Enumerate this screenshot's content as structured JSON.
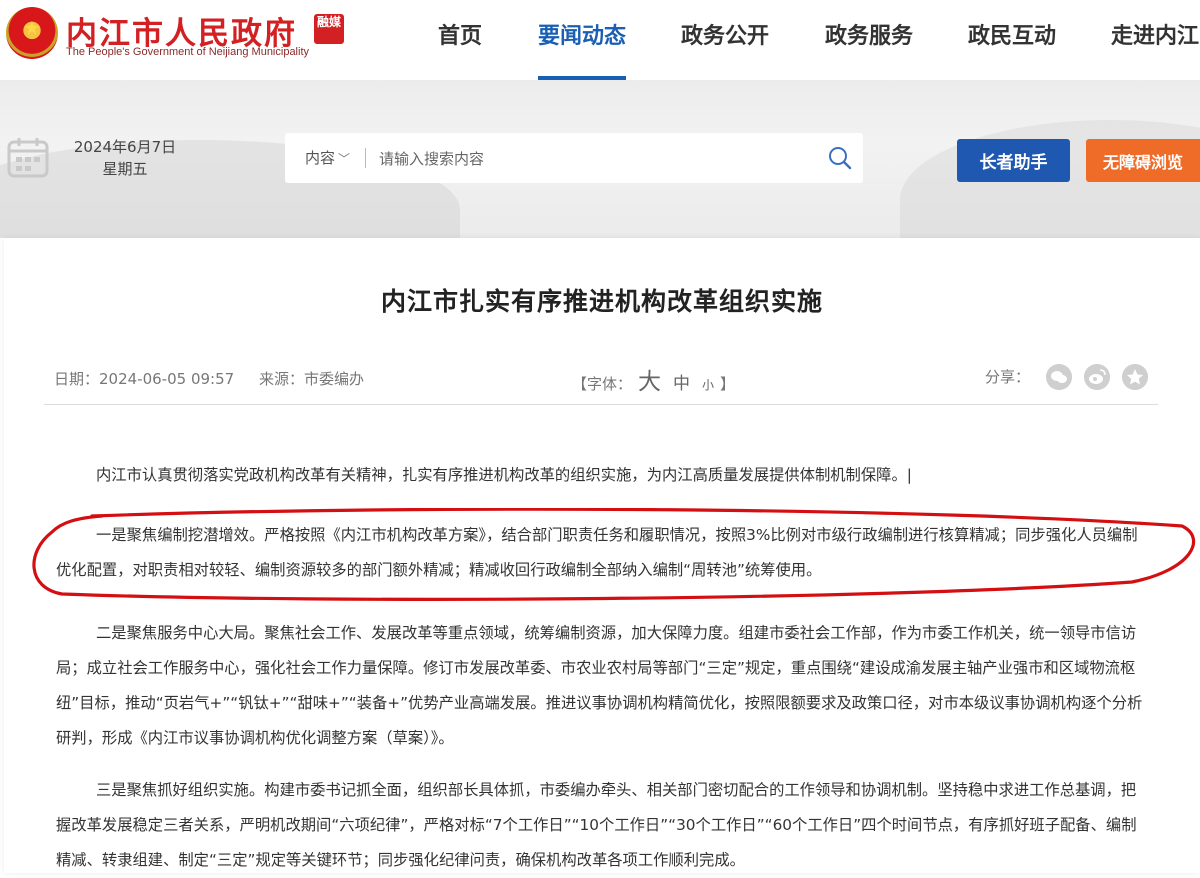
{
  "header": {
    "site_name": "内江市人民政府",
    "site_badge": "融媒",
    "site_english": "The People's Government of Neijiang Municipality",
    "nav": [
      {
        "label": "首页",
        "active": false
      },
      {
        "label": "要闻动态",
        "active": true
      },
      {
        "label": "政务公开",
        "active": false
      },
      {
        "label": "政务服务",
        "active": false
      },
      {
        "label": "政民互动",
        "active": false
      },
      {
        "label": "走进内江",
        "active": false
      }
    ]
  },
  "banner": {
    "date": "2024年6月7日",
    "weekday": "星期五",
    "search_scope": "内容",
    "search_placeholder": "请输入搜索内容",
    "elder_button": "长者助手",
    "access_button": "无障碍浏览"
  },
  "article": {
    "title": "内江市扎实有序推进机构改革组织实施",
    "date_label": "日期：2024-06-05 09:57",
    "source_label": "来源：市委编办",
    "font_label_open": "【字体：",
    "font_big": "大",
    "font_mid": "中",
    "font_small": "小",
    "font_label_close": "】",
    "share_label": "分享：",
    "paragraphs": [
      "内江市认真贯彻落实党政机构改革有关精神，扎实有序推进机构改革的组织实施，为内江高质量发展提供体制机制保障。|",
      "一是聚焦编制挖潜增效。严格按照《内江市机构改革方案》，结合部门职责任务和履职情况，按照3%比例对市级行政编制进行核算精减；同步强化人员编制优化配置，对职责相对较轻、编制资源较多的部门额外精减；精减收回行政编制全部纳入编制“周转池”统筹使用。",
      "二是聚焦服务中心大局。聚焦社会工作、发展改革等重点领域，统筹编制资源，加大保障力度。组建市委社会工作部，作为市委工作机关，统一领导市信访局；成立社会工作服务中心，强化社会工作力量保障。修订市发展改革委、市农业农村局等部门“三定”规定，重点围绕“建设成渝发展主轴产业强市和区域物流枢纽”目标，推动“页岩气+”“钒钛+”“甜味+”“装备+”优势产业高端发展。推进议事协调机构精简优化，按照限额要求及政策口径，对市本级议事协调机构逐个分析研判，形成《内江市议事协调机构优化调整方案（草案）》。",
      "三是聚焦抓好组织实施。构建市委书记抓全面，组织部长具体抓，市委编办牵头、相关部门密切配合的工作领导和协调机制。坚持稳中求进工作总基调，把握改革发展稳定三者关系，严明机改期间“六项纪律”，严格对标“7个工作日”“10个工作日”“30个工作日”“60个工作日”四个时间节点，有序抓好班子配备、编制精减、转隶组建、制定“三定”规定等关键环节；同步强化纪律问责，确保机构改革各项工作顺利完成。"
    ]
  },
  "colors": {
    "brand_red": "#d32023",
    "nav_active": "#1b5fb3",
    "elder_button": "#1e58b0",
    "access_button": "#ee6b28",
    "annotation_red": "#d40f12"
  }
}
